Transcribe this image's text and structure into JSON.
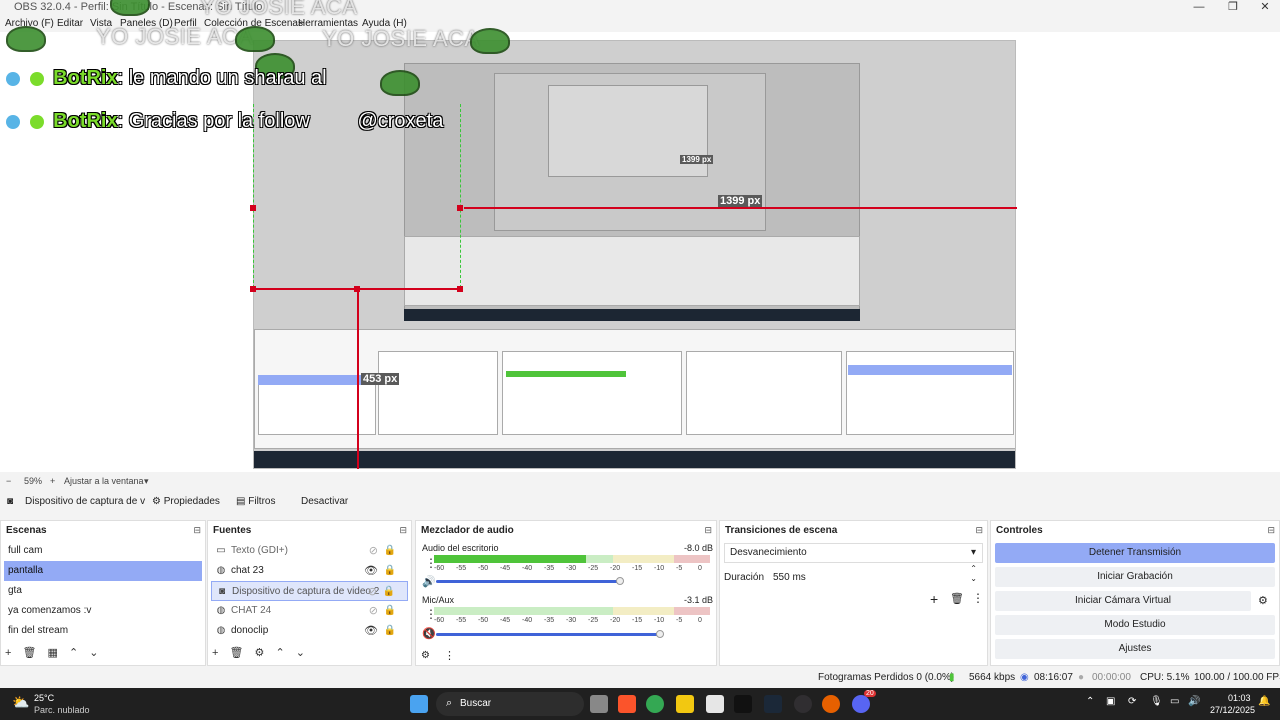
{
  "window": {
    "title": "OBS 32.0.4 - Perfil: Sin Título - Escenas: Sin Título",
    "minimize": "—",
    "maximize": "❐",
    "close": "✕"
  },
  "menu": [
    "Archivo (F)",
    "Editar",
    "Vista",
    "Paneles (D)",
    "Perfil",
    "Colección de Escenas",
    "Herramientas",
    "Ayuda (H)"
  ],
  "overlay": {
    "watermark": "YO JOSIE ACA",
    "chat": [
      {
        "user": "BotRix",
        "message": ": le mando un sharau al"
      },
      {
        "user": "BotRix",
        "message": ": Gracias por la follow",
        "mention": "@croxeta"
      }
    ]
  },
  "preview": {
    "measure_large": "1399 px",
    "measure_side": "453 px",
    "measure_small": "1399 px"
  },
  "zoom": {
    "level": "59%",
    "fit_label": "Ajustar a la ventana"
  },
  "source_toolbar": {
    "source_name": "Dispositivo de captura de v",
    "properties": "Propiedades",
    "filters": "Filtros",
    "deactivate": "Desactivar"
  },
  "scenes": {
    "title": "Escenas",
    "items": [
      "full cam",
      "pantalla",
      "gta",
      "ya comenzamos :v",
      "fin del stream"
    ],
    "selected": 1
  },
  "sources": {
    "title": "Fuentes",
    "items": [
      {
        "name": "Texto (GDI+)",
        "icon": "text-icon",
        "visible": false
      },
      {
        "name": "chat 23",
        "icon": "browser-icon",
        "visible": true
      },
      {
        "name": "Dispositivo de captura de video 2",
        "icon": "camera-icon",
        "visible": false
      },
      {
        "name": "CHAT 24",
        "icon": "browser-icon",
        "visible": false
      },
      {
        "name": "donoclip",
        "icon": "browser-icon",
        "visible": true
      }
    ],
    "selected": 2
  },
  "mixer": {
    "title": "Mezclador de audio",
    "channels": [
      {
        "name": "Audio del escritorio",
        "db": "-8.0 dB",
        "level": 0.55,
        "fader": 0.68
      },
      {
        "name": "Mic/Aux",
        "db": "-3.1 dB",
        "level": 0.0,
        "fader": 0.83
      }
    ],
    "ticks": [
      "-60",
      "-55",
      "-50",
      "-45",
      "-40",
      "-35",
      "-30",
      "-25",
      "-20",
      "-15",
      "-10",
      "-5",
      "0"
    ]
  },
  "transitions": {
    "title": "Transiciones de escena",
    "selected": "Desvanecimiento",
    "duration_label": "Duración",
    "duration_value": "550 ms"
  },
  "controls": {
    "title": "Controles",
    "buttons": [
      "Detener Transmisión",
      "Iniciar Grabación",
      "Iniciar Cámara Virtual",
      "Modo Estudio",
      "Ajustes"
    ]
  },
  "status": {
    "dropped": "Fotogramas Perdidos 0 (0.0%)",
    "bitrate": "5664 kbps",
    "stream_time": "08:16:07",
    "record_time": "00:00:00",
    "cpu": "CPU: 5.1%",
    "fps": "100.00 / 100.00 FPS"
  },
  "taskbar": {
    "weather_temp": "25°C",
    "weather_desc": "Parc. nublado",
    "search": "Buscar",
    "time": "01:03",
    "date": "27/12/2025",
    "discord_badge": "20"
  },
  "colors": {
    "accent": "#93aaf5",
    "guide": "#d3001c",
    "meter_green": "#4fc43a",
    "meter_yellow": "#d8c23a",
    "meter_red": "#c23a3a",
    "fader": "#3f63d8"
  }
}
